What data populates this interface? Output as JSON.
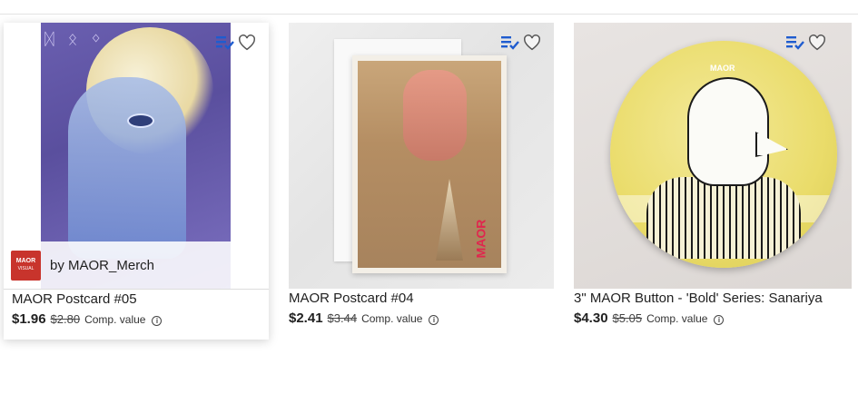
{
  "products": [
    {
      "title": "MAOR Postcard #05",
      "price": "$1.96",
      "original_price": "$2.80",
      "comp_label": "Comp. value",
      "byline": "by MAOR_Merch",
      "store_logo_text": "MAOR",
      "store_logo_sub": "VISUAL",
      "hovered": true
    },
    {
      "title": "MAOR Postcard #04",
      "price": "$2.41",
      "original_price": "$3.44",
      "comp_label": "Comp. value"
    },
    {
      "title": "3\" MAOR Button - 'Bold' Series: Sanariya",
      "price": "$4.30",
      "original_price": "$5.05",
      "comp_label": "Comp. value",
      "thumb_brand_text": "MAOR"
    }
  ],
  "icons": {
    "add_to_list": "playlist-check-icon",
    "favorite": "heart-outline-icon",
    "info": "info-circle-icon"
  },
  "colors": {
    "accent_blue": "#1f5ccf",
    "logo_red": "#c8342c",
    "text": "#212121"
  }
}
